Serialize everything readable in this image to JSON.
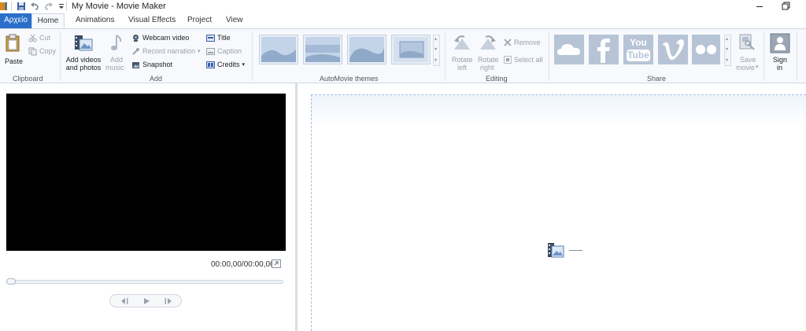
{
  "window": {
    "title": "My Movie - Movie Maker",
    "icons": [
      "app-icon",
      "save-icon",
      "undo-icon",
      "redo-icon",
      "customize-quick-access-icon",
      "minimize-icon",
      "restore-icon"
    ]
  },
  "tabs": [
    {
      "label": "Αρχείο",
      "active": false
    },
    {
      "label": "Home",
      "active": true
    },
    {
      "label": "Animations",
      "active": false
    },
    {
      "label": "Visual Effects",
      "active": false
    },
    {
      "label": "Project",
      "active": false
    },
    {
      "label": "View",
      "active": false
    }
  ],
  "ribbon": {
    "clipboard": {
      "group_label": "Clipboard",
      "paste": "Paste",
      "cut": "Cut",
      "copy": "Copy"
    },
    "add": {
      "group_label": "Add",
      "add_videos_line1": "Add videos",
      "add_videos_line2": "and photos",
      "add_music_line1": "Add",
      "add_music_line2": "music",
      "webcam_video": "Webcam video",
      "record_narration": "Record narration",
      "snapshot": "Snapshot",
      "title": "Title",
      "caption": "Caption",
      "credits": "Credits"
    },
    "themes": {
      "group_label": "AutoMovie themes",
      "count": 4
    },
    "editing": {
      "group_label": "Editing",
      "rotate_left_line1": "Rotate",
      "rotate_left_line2": "left",
      "rotate_right_line1": "Rotate",
      "rotate_right_line2": "right",
      "remove": "Remove",
      "select_all": "Select all"
    },
    "share": {
      "group_label": "Share",
      "services": [
        "onedrive-icon",
        "facebook-icon",
        "youtube-icon",
        "vimeo-icon",
        "flickr-icon"
      ],
      "youtube_line1": "You",
      "youtube_line2": "Tube",
      "save_movie_line1": "Save",
      "save_movie_line2": "movie",
      "sign_in_line1": "Sign",
      "sign_in_line2": "in"
    }
  },
  "player": {
    "time": "00:00,00/00:00,00",
    "seek_fraction": 0
  },
  "colors": {
    "file_tab": "#2a6fc9",
    "ribbon_bg": "#f7f9fc",
    "share_tile": "#b7c4d6",
    "preview_bg": "#000000",
    "storyboard_border": "#9fbfe0"
  }
}
